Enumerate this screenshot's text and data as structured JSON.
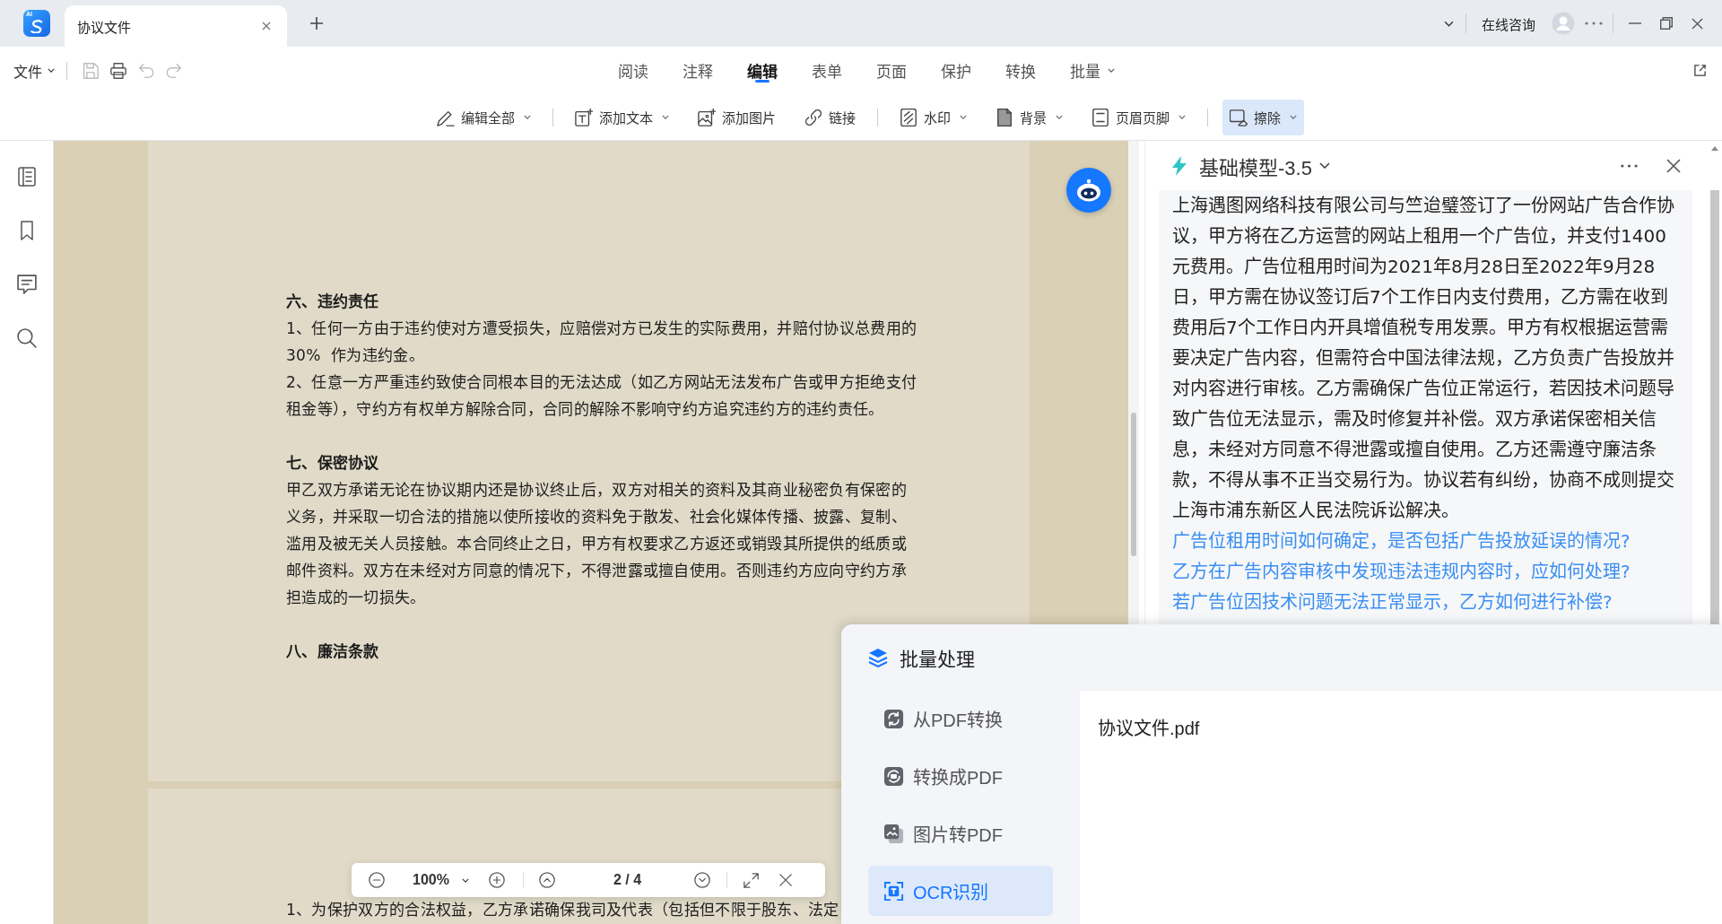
{
  "title_bar": {
    "logo_badge": "AI",
    "tabs": [
      {
        "label": "协议文件",
        "selected": true
      }
    ],
    "consult": "在线咨询"
  },
  "menu_bar": {
    "file_menu": "文件",
    "quick_tools": [
      {
        "kind": "save",
        "disabled": true
      },
      {
        "kind": "print",
        "disabled": false
      },
      {
        "kind": "undo",
        "disabled": true
      },
      {
        "kind": "redo",
        "disabled": true
      }
    ],
    "tabs": [
      {
        "label": "阅读",
        "selected": false,
        "dropdown": false
      },
      {
        "label": "注释",
        "selected": false,
        "dropdown": false
      },
      {
        "label": "编辑",
        "selected": true,
        "dropdown": false
      },
      {
        "label": "表单",
        "selected": false,
        "dropdown": false
      },
      {
        "label": "页面",
        "selected": false,
        "dropdown": false
      },
      {
        "label": "保护",
        "selected": false,
        "dropdown": false
      },
      {
        "label": "转换",
        "selected": false,
        "dropdown": false
      },
      {
        "label": "批量",
        "selected": false,
        "dropdown": true
      }
    ]
  },
  "toolbar": {
    "groups": [
      [
        {
          "kind": "edit-all",
          "label": "编辑全部",
          "dropdown": true,
          "selected": false
        }
      ],
      [
        {
          "kind": "add-text",
          "label": "添加文本",
          "dropdown": true,
          "selected": false
        },
        {
          "kind": "add-image",
          "label": "添加图片",
          "dropdown": false,
          "selected": false
        },
        {
          "kind": "link",
          "label": "链接",
          "dropdown": false,
          "selected": false
        }
      ],
      [
        {
          "kind": "watermark",
          "label": "水印",
          "dropdown": true,
          "selected": false
        },
        {
          "kind": "background",
          "label": "背景",
          "dropdown": true,
          "selected": false
        },
        {
          "kind": "header-footer",
          "label": "页眉页脚",
          "dropdown": true,
          "selected": false
        }
      ],
      [
        {
          "kind": "erase",
          "label": "擦除",
          "dropdown": true,
          "selected": true
        }
      ]
    ]
  },
  "document": {
    "pages": [
      {
        "sections": [
          {
            "heading": "六、违约责任",
            "paragraphs": [
              "1、任何一方由于违约使对方遭受损失，应赔偿对方已发生的实际费用，并赔付协议总费用的30%  作为违约金。",
              "2、任意一方严重违约致使合同根本目的无法达成（如乙方网站无法发布广告或甲方拒绝支付租金等），守约方有权单方解除合同，合同的解除不影响守约方追究违约方的违约责任。"
            ]
          },
          {
            "heading": "七、保密协议",
            "paragraphs": [
              "甲乙双方承诺无论在协议期内还是协议终止后，双方对相关的资料及其商业秘密负有保密的义务，并采取一切合法的措施以使所接收的资料免于散发、社会化媒体传播、披露、复制、滥用及被无关人员接触。本合同终止之日，甲方有权要求乙方返还或销毁其所提供的纸质或邮件资料。双方在未经对方同意的情况下，不得泄露或擅自使用。否则违约方应向守约方承担造成的一切损失。"
            ]
          },
          {
            "heading": "八、廉洁条款"
          }
        ]
      },
      {
        "sections": [
          {
            "paragraphs": [
              "1、为保护双方的合法权益，乙方承诺确保我司及代表（包括但不限于股东、法定"
            ]
          }
        ]
      }
    ]
  },
  "zoom_bar": {
    "zoom": "100%",
    "page": "2 / 4"
  },
  "ai_panel": {
    "model": "基础模型-3.5",
    "answer": "上海遇图网络科技有限公司与竺迨璧签订了一份网站广告合作协议，甲方将在乙方运营的网站上租用一个广告位，并支付1400元费用。广告位租用时间为2021年8月28日至2022年9月28日，甲方需在协议签订后7个工作日内支付费用，乙方需在收到费用后7个工作日内开具增值税专用发票。甲方有权根据运营需要决定广告内容，但需符合中国法律法规，乙方负责广告投放并对内容进行审核。乙方需确保广告位正常运行，若因技术问题导致广告位无法显示，需及时修复并补偿。双方承诺保密相关信息，未经对方同意不得泄露或擅自使用。乙方还需遵守廉洁条款，不得从事不正当交易行为。协议若有纠纷，协商不成则提交上海市浦东新区人民法院诉讼解决。",
    "suggestions": [
      "广告位租用时间如何确定，是否包括广告投放延误的情况?",
      "乙方在广告内容审核中发现违法违规内容时，应如何处理?",
      "若广告位因技术问题无法正常显示，乙方如何进行补偿?"
    ]
  },
  "batch_panel": {
    "title": "批量处理",
    "items": [
      {
        "kind": "from-pdf",
        "label": "从PDF转换",
        "selected": false
      },
      {
        "kind": "to-pdf",
        "label": "转换成PDF",
        "selected": false
      },
      {
        "kind": "image-to-pdf",
        "label": "图片转PDF",
        "selected": false
      },
      {
        "kind": "ocr",
        "label": "OCR识别",
        "selected": true
      }
    ],
    "files": [
      "协议文件.pdf"
    ]
  }
}
